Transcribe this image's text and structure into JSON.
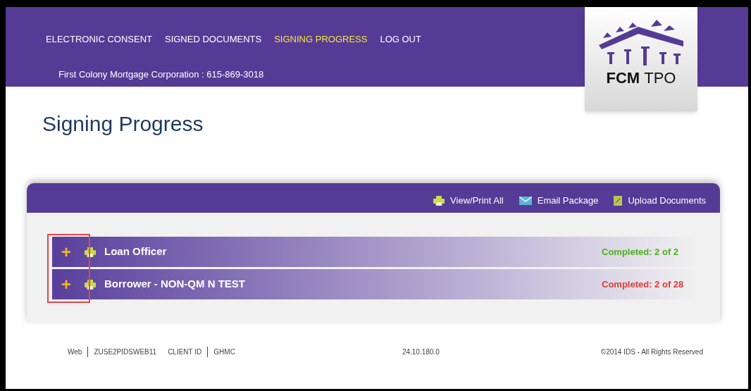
{
  "nav": [
    {
      "label": "ELECTRONIC CONSENT",
      "selected": false
    },
    {
      "label": "SIGNED DOCUMENTS",
      "selected": false
    },
    {
      "label": "SIGNING PROGRESS",
      "selected": true
    },
    {
      "label": "LOG OUT",
      "selected": false
    }
  ],
  "company": "First Colony Mortgage Corporation : 615-869-3018",
  "logo": {
    "text_bold": "FCM",
    "text": "TPO"
  },
  "title": "Signing Progress",
  "actions": [
    {
      "label": "View/Print All",
      "kind": "print"
    },
    {
      "label": "Email Package",
      "kind": "email"
    },
    {
      "label": "Upload Documents",
      "kind": "upload"
    }
  ],
  "signers": [
    {
      "expander": "+",
      "name": "Loan Officer",
      "status": "Completed: 2 of 2",
      "color": "#4caf1c"
    },
    {
      "expander": "+",
      "name": "Borrower - NON-QM N TEST",
      "status": "Completed: 2 of 28",
      "color": "#e53935"
    }
  ],
  "footer": {
    "items": [
      "Web",
      "ZUSE2PIDSWEB11",
      "CLIENT ID",
      "GHMC"
    ],
    "version": "24.10.180.0",
    "copyright": "©2014 IDS - All Rights Reserved"
  }
}
